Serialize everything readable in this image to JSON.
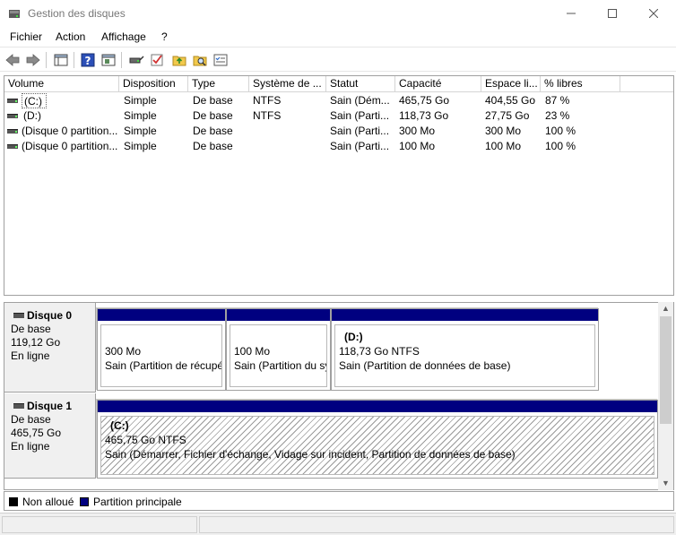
{
  "window": {
    "title": "Gestion des disques"
  },
  "menu": [
    {
      "label": "Fichier"
    },
    {
      "label": "Action"
    },
    {
      "label": "Affichage"
    },
    {
      "label": "?"
    }
  ],
  "toolbar": [
    {
      "icon": "back-arrow-icon"
    },
    {
      "icon": "forward-arrow-icon"
    },
    {
      "icon": "console-tree-icon"
    },
    {
      "icon": "help-icon"
    },
    {
      "icon": "properties-window-icon"
    },
    {
      "icon": "connect-disk-icon"
    },
    {
      "icon": "checklist-icon"
    },
    {
      "icon": "folder-up-icon"
    },
    {
      "icon": "folder-search-icon"
    },
    {
      "icon": "settings-list-icon"
    }
  ],
  "volume_list": {
    "columns": [
      "Volume",
      "Disposition",
      "Type",
      "Système de ...",
      "Statut",
      "Capacité",
      "Espace li...",
      "% libres"
    ],
    "rows": [
      [
        "(C:)",
        "Simple",
        "De base",
        "NTFS",
        "Sain (Dém...",
        "465,75 Go",
        "404,55 Go",
        "87 %"
      ],
      [
        "(D:)",
        "Simple",
        "De base",
        "NTFS",
        "Sain (Parti...",
        "118,73 Go",
        "27,75 Go",
        "23 %"
      ],
      [
        "(Disque 0 partition...",
        "Simple",
        "De base",
        "",
        "Sain (Parti...",
        "300 Mo",
        "300 Mo",
        "100 %"
      ],
      [
        "(Disque 0 partition...",
        "Simple",
        "De base",
        "",
        "Sain (Parti...",
        "100 Mo",
        "100 Mo",
        "100 %"
      ]
    ]
  },
  "disks": [
    {
      "name": "Disque 0",
      "type": "De base",
      "size": "119,12 Go",
      "state": "En ligne",
      "partitions": [
        {
          "label": "",
          "size": "300 Mo",
          "status": "Sain (Partition de récupé"
        },
        {
          "label": "",
          "size": "100 Mo",
          "status": "Sain (Partition du sy"
        },
        {
          "label": "(D:)",
          "size": "118,73 Go NTFS",
          "status": "Sain (Partition de données de base)"
        }
      ]
    },
    {
      "name": "Disque 1",
      "type": "De base",
      "size": "465,75 Go",
      "state": "En ligne",
      "partitions": [
        {
          "label": "(C:)",
          "size": "465,75 Go NTFS",
          "status": "Sain (Démarrer, Fichier d'échange, Vidage sur incident, Partition de données de base)"
        }
      ]
    }
  ],
  "legend": [
    {
      "label": "Non alloué",
      "color": "#000000"
    },
    {
      "label": "Partition principale",
      "color": "#000080"
    }
  ]
}
